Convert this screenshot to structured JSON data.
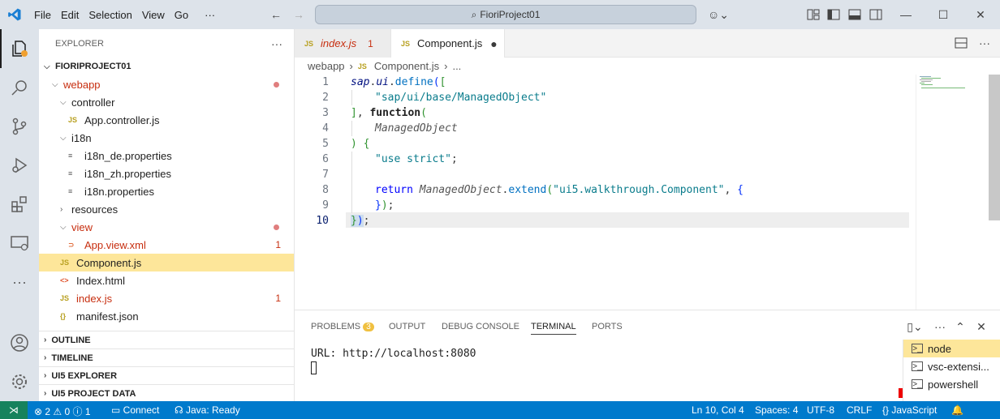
{
  "menu": [
    "File",
    "Edit",
    "Selection",
    "View",
    "Go",
    "···"
  ],
  "command_center": "FioriProject01",
  "explorer": {
    "header": "EXPLORER",
    "project": "FIORIPROJECT01",
    "tree": [
      {
        "label": "webapp",
        "type": "folder",
        "indent": 1,
        "open": true,
        "color": "#c72e0f",
        "dot": true
      },
      {
        "label": "controller",
        "type": "folder",
        "indent": 2,
        "open": true
      },
      {
        "label": "App.controller.js",
        "type": "js",
        "indent": 3
      },
      {
        "label": "i18n",
        "type": "folder",
        "indent": 2,
        "open": true
      },
      {
        "label": "i18n_de.properties",
        "type": "prop",
        "indent": 3
      },
      {
        "label": "i18n_zh.properties",
        "type": "prop",
        "indent": 3
      },
      {
        "label": "i18n.properties",
        "type": "prop",
        "indent": 3
      },
      {
        "label": "resources",
        "type": "folder",
        "indent": 2,
        "open": false
      },
      {
        "label": "view",
        "type": "folder",
        "indent": 2,
        "open": true,
        "color": "#c72e0f",
        "dot": true
      },
      {
        "label": "App.view.xml",
        "type": "xml",
        "indent": 3,
        "color": "#c72e0f",
        "badge": "1"
      },
      {
        "label": "Component.js",
        "type": "js",
        "indent": 2,
        "selected": true
      },
      {
        "label": "Index.html",
        "type": "html",
        "indent": 2
      },
      {
        "label": "index.js",
        "type": "js",
        "indent": 2,
        "color": "#c72e0f",
        "badge": "1"
      },
      {
        "label": "manifest.json",
        "type": "json",
        "indent": 2
      }
    ],
    "sections": [
      "OUTLINE",
      "TIMELINE",
      "UI5 EXPLORER",
      "UI5 PROJECT DATA"
    ]
  },
  "tabs": [
    {
      "label": "index.js",
      "badge": "1",
      "active": false
    },
    {
      "label": "Component.js",
      "active": true
    }
  ],
  "breadcrumb": {
    "folder": "webapp",
    "file": "Component.js",
    "rest": "..."
  },
  "code_lines": [
    "1",
    "2",
    "3",
    "4",
    "5",
    "6",
    "7",
    "8",
    "9",
    "10"
  ],
  "code": {
    "l1a": "sap",
    "l1b": ".",
    "l1c": "ui",
    "l1d": ".",
    "l1e": "define",
    "l1f": "(",
    "l1g": "[",
    "l2": "\"sap/ui/base/ManagedObject\"",
    "l3a": "]",
    ", ": "",
    "l3b": ", ",
    "l3c": "function",
    "l3d": "(",
    "l4": "ManagedObject",
    "l5a": ")",
    "l5b": " ",
    "l5c": "{",
    "l6a": "\"use strict\"",
    "l6b": ";",
    "l8a": "return",
    "l8b": "ManagedObject",
    "l8c": ".",
    "l8d": "extend",
    "l8e": "(",
    "l8f": "\"ui5.walkthrough.Component\"",
    "l8g": ", ",
    "l8h": "{",
    "l9a": "}",
    "l9b": ")",
    "l9c": ";",
    "l10a": "}",
    "l10b": ")",
    "l10c": ";"
  },
  "panel": {
    "tabs": [
      "PROBLEMS",
      "OUTPUT",
      "DEBUG CONSOLE",
      "TERMINAL",
      "PORTS"
    ],
    "problems_count": "3",
    "terminal_line1": "URL: http://localhost:8080",
    "terminals": [
      "node",
      "vsc-extensi...",
      "powershell"
    ]
  },
  "status": {
    "errors": "2",
    "warnings": "0",
    "info": "1",
    "connect": "Connect",
    "java": "Java: Ready",
    "position": "Ln 10, Col 4",
    "spaces": "Spaces: 4",
    "encoding": "UTF-8",
    "eol": "CRLF",
    "language": "JavaScript"
  },
  "colors": {
    "statusbar": "#007acc",
    "selection": "#fde69a",
    "error": "#c72e0f"
  }
}
